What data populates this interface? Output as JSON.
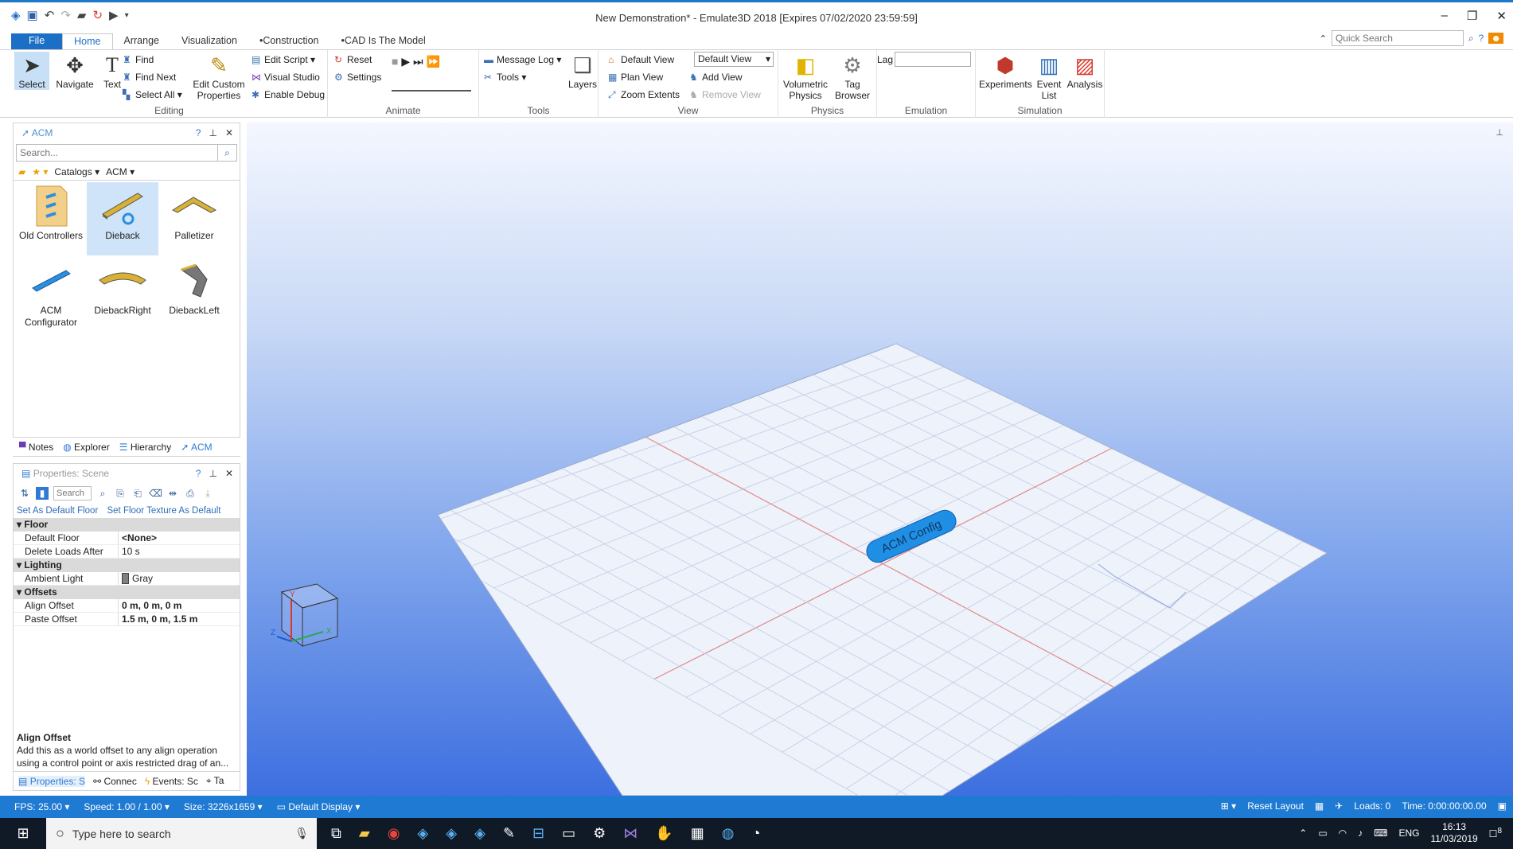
{
  "window": {
    "title": "New Demonstration* - Emulate3D 2018 [Expires 07/02/2020 23:59:59]"
  },
  "qat_icons": [
    "save-icon",
    "undo-icon",
    "redo-icon",
    "open-icon",
    "reset-icon",
    "play-icon"
  ],
  "ribbon_tabs": [
    {
      "label": "File"
    },
    {
      "label": "Home"
    },
    {
      "label": "Arrange"
    },
    {
      "label": "Visualization"
    },
    {
      "label": "•Construction"
    },
    {
      "label": "•CAD Is The Model"
    }
  ],
  "quick_search": {
    "placeholder": "Quick Search"
  },
  "editing": {
    "label": "Editing",
    "select": "Select",
    "navigate": "Navigate",
    "text": "Text",
    "find": "Find",
    "find_next": "Find Next",
    "select_all": "Select All",
    "edit_custom": "Edit Custom Properties"
  },
  "scripting": {
    "edit_script": "Edit Script",
    "visual_studio": "Visual Studio",
    "enable_debug": "Enable Debug"
  },
  "animate": {
    "label": "Animate",
    "reset": "Reset",
    "settings": "Settings"
  },
  "tools": {
    "label": "Tools",
    "message_log": "Message Log",
    "tools": "Tools",
    "layers": "Layers"
  },
  "view": {
    "label": "View",
    "default_view": "Default View",
    "plan_view": "Plan View",
    "zoom_extents": "Zoom Extents",
    "view_select": "Default View",
    "add_view": "Add View",
    "remove_view": "Remove View"
  },
  "physics": {
    "label": "Physics",
    "volumetric": "Volumetric Physics",
    "tag_browser": "Tag Browser"
  },
  "emulation": {
    "label": "Emulation",
    "lag": "Lag"
  },
  "simulation": {
    "label": "Simulation",
    "experiments": "Experiments",
    "event_list": "Event List",
    "analysis": "Analysis"
  },
  "acm_panel": {
    "title": "ACM",
    "search_placeholder": "Search...",
    "catalogs": "Catalogs",
    "acm": "ACM",
    "items": [
      {
        "label": "Old Controllers"
      },
      {
        "label": "Dieback"
      },
      {
        "label": "Palletizer"
      },
      {
        "label": "ACM Configurator"
      },
      {
        "label": "DiebackRight"
      },
      {
        "label": "DiebackLeft"
      }
    ],
    "tabs": [
      {
        "label": "Notes"
      },
      {
        "label": "Explorer"
      },
      {
        "label": "Hierarchy"
      },
      {
        "label": "ACM"
      }
    ]
  },
  "props_panel": {
    "title": "Properties: Scene",
    "search_placeholder": "Search",
    "link1": "Set As Default Floor",
    "link2": "Set Floor Texture As Default",
    "categories": [
      {
        "name": "Floor",
        "rows": [
          {
            "name": "Default Floor",
            "value": "<None>"
          },
          {
            "name": "Delete Loads After",
            "value": "10 s"
          }
        ]
      },
      {
        "name": "Lighting",
        "rows": [
          {
            "name": "Ambient Light",
            "value": "Gray"
          }
        ]
      },
      {
        "name": "Offsets",
        "rows": [
          {
            "name": "Align Offset",
            "value": "0 m, 0 m, 0 m"
          },
          {
            "name": "Paste Offset",
            "value": "1.5 m, 0 m, 1.5 m"
          }
        ]
      }
    ],
    "desc_title": "Align Offset",
    "desc_text": "Add this as a world offset to any align operation using a control point or axis restricted drag of an...",
    "bottom_tabs": [
      {
        "label": "Properties: S"
      },
      {
        "label": "Connec"
      },
      {
        "label": "Events: Sc"
      },
      {
        "label": "Ta"
      }
    ]
  },
  "viewport": {
    "acm_label": "ACM Config",
    "axes": {
      "x": "X",
      "y": "Y",
      "z": "Z"
    }
  },
  "statusbar": {
    "fps": "FPS: 25.00",
    "speed": "Speed: 1.00 / 1.00",
    "size": "Size: 3226x1659",
    "display": "Default Display",
    "reset_layout": "Reset Layout",
    "loads": "Loads: 0",
    "time": "Time: 0:00:00:00.00"
  },
  "taskbar": {
    "search_placeholder": "Type here to search",
    "lang": "ENG",
    "time": "16:13",
    "date": "11/03/2019",
    "notif": "8"
  },
  "colors": {
    "accent": "#1e7ad2",
    "viewport_top": "#f4f7ff",
    "viewport_bottom": "#3d6fe0"
  }
}
